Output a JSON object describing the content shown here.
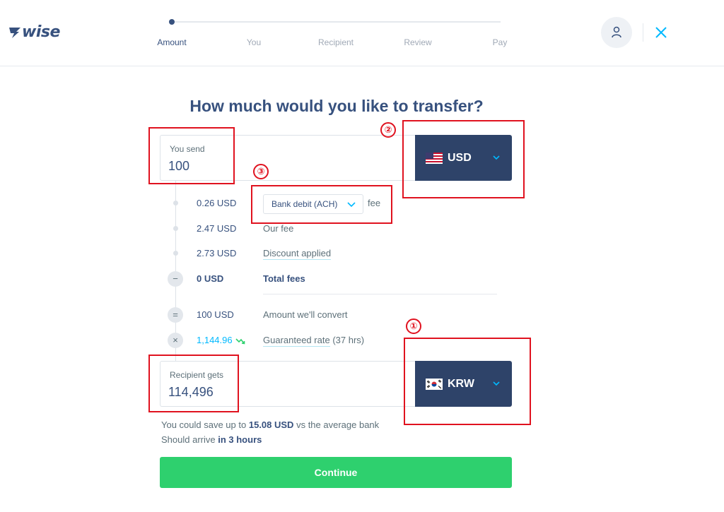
{
  "brand": {
    "logo_text": "wise"
  },
  "stepper": {
    "steps": [
      {
        "label": "Amount"
      },
      {
        "label": "You"
      },
      {
        "label": "Recipient"
      },
      {
        "label": "Review"
      },
      {
        "label": "Pay"
      }
    ],
    "active_index": 0
  },
  "header_icons": {
    "avatar": "user-icon",
    "close": "close-icon"
  },
  "title": "How much would you like to transfer?",
  "send": {
    "label": "You send",
    "value": "100",
    "currency": "USD",
    "flag": "us-flag-icon"
  },
  "fees": {
    "method_fee": "0.26 USD",
    "method_selected": "Bank debit (ACH)",
    "fee_word": "fee",
    "our_fee_amount": "2.47 USD",
    "our_fee_label": "Our fee",
    "discount_amount": "2.73 USD",
    "discount_label": "Discount applied",
    "total_amount": "0 USD",
    "total_label": "Total fees",
    "total_symbol": "−"
  },
  "convert": {
    "symbol": "=",
    "amount": "100 USD",
    "label": "Amount we'll convert"
  },
  "rate": {
    "symbol": "×",
    "value": "1,144.96",
    "label": "Guaranteed rate",
    "duration": "(37 hrs)"
  },
  "receive": {
    "label": "Recipient gets",
    "value": "114,496",
    "currency": "KRW",
    "flag": "kr-flag-icon"
  },
  "savings": {
    "prefix": "You could save up to",
    "amount": "15.08 USD",
    "suffix": "vs the average bank"
  },
  "arrival": {
    "prefix": "Should arrive",
    "time": "in 3 hours"
  },
  "continue_label": "Continue",
  "annotations": [
    "①",
    "②",
    "③"
  ],
  "colors": {
    "navy": "#2e4369",
    "accent": "#00b9ff",
    "cta": "#2ed06e",
    "annotation": "#e0121f"
  }
}
